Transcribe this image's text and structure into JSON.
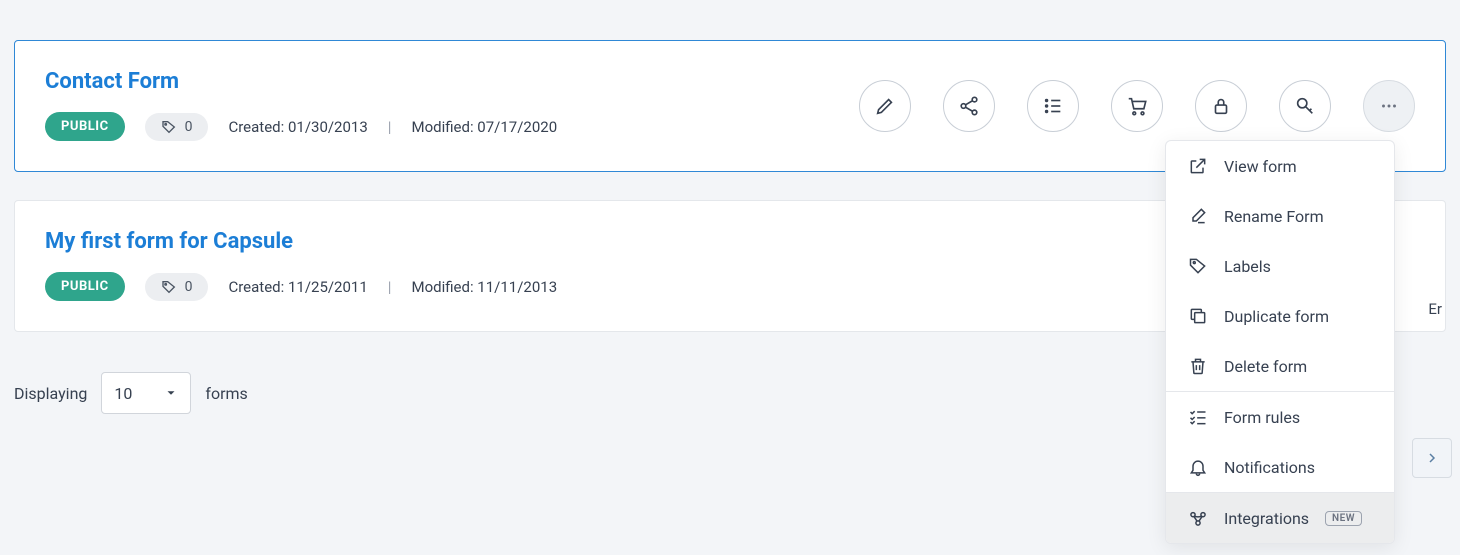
{
  "forms": [
    {
      "title": "Contact Form",
      "status": "PUBLIC",
      "tag_count": "0",
      "created_label": "Created: 01/30/2013",
      "modified_label": "Modified: 07/17/2020"
    },
    {
      "title": "My first form for Capsule",
      "status": "PUBLIC",
      "tag_count": "0",
      "created_label": "Created: 11/25/2011",
      "modified_label": "Modified: 11/11/2013"
    }
  ],
  "partial_text": "Er",
  "dropdown": {
    "view": "View form",
    "rename": "Rename Form",
    "labels": "Labels",
    "duplicate": "Duplicate form",
    "delete": "Delete form",
    "rules": "Form rules",
    "notifications": "Notifications",
    "integrations": "Integrations",
    "new_badge": "NEW"
  },
  "footer": {
    "displaying": "Displaying",
    "count": "10",
    "forms": "forms"
  }
}
